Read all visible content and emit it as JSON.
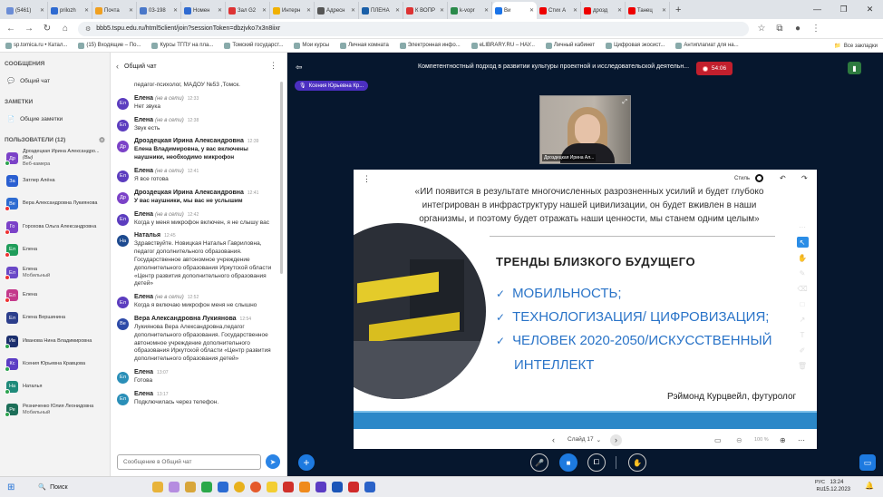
{
  "browser": {
    "tabs": [
      {
        "label": "(5461)",
        "color": "#6b8dd6"
      },
      {
        "label": "prilozh",
        "color": "#2e6ad1"
      },
      {
        "label": "Почта",
        "color": "#f0a020"
      },
      {
        "label": "03-198",
        "color": "#4a78c9"
      },
      {
        "label": "Номен",
        "color": "#2e6ad1"
      },
      {
        "label": "Зал G2",
        "color": "#d33"
      },
      {
        "label": "Интерн",
        "color": "#f0b000"
      },
      {
        "label": "Адресн",
        "color": "#555"
      },
      {
        "label": "ПЛЕНА",
        "color": "#1a5fa8"
      },
      {
        "label": "К ВОПР",
        "color": "#d33"
      },
      {
        "label": "k-vopr",
        "color": "#2a8a4a"
      },
      {
        "label": "Ви",
        "color": "#1a73e8"
      },
      {
        "label": "Стих А",
        "color": "#e00"
      },
      {
        "label": "дрозд",
        "color": "#e00"
      },
      {
        "label": "Танец",
        "color": "#e00"
      }
    ],
    "active_tab_index": 11,
    "new_tab": "+",
    "url": "bbb5.tspu.edu.ru/html5client/join?sessionToken=dbzjvko7x3n8iixr",
    "bookmarks": [
      "sp.tomica.ru • Катал...",
      "(15) Входящие – По...",
      "Курсы ТГПУ на пла...",
      "Томский государст...",
      "Мои курсы",
      "Личная комната",
      "Электронная инфо...",
      "eLIBRARY.RU – НАУ...",
      "Личный кабинет",
      "Цифровая экосист...",
      "Антиплагиат для на..."
    ],
    "all_bookmarks": "Все закладки"
  },
  "sidebar": {
    "messages_header": "СООБЩЕНИЯ",
    "public_chat": "Общий чат",
    "notes_header": "ЗАМЕТКИ",
    "shared_notes": "Общие заметки",
    "users_header": "ПОЛЬЗОВАТЕЛИ (12)",
    "users": [
      {
        "initials": "Др",
        "name": "Дроздецкая Ирина Александро...",
        "note": "(Вы)",
        "sub": "Веб-камера",
        "color": "#7b42c8",
        "dot": "#2ea44f"
      },
      {
        "initials": "За",
        "name": "Затлер Алёна",
        "sub": "",
        "color": "#2a5fd1",
        "dot": ""
      },
      {
        "initials": "Ве",
        "name": "Вера Александровна Лукиянова",
        "sub": "",
        "color": "#2d6bd1",
        "dot": "#e33"
      },
      {
        "initials": "Го",
        "name": "Горохова Ольга Александровна",
        "sub": "",
        "color": "#7b42c8",
        "dot": "#e33"
      },
      {
        "initials": "Ел",
        "name": "Елена",
        "sub": "",
        "color": "#1f9d5a",
        "dot": "#e33"
      },
      {
        "initials": "Ел",
        "name": "Елена",
        "sub": "Мобильный",
        "color": "#6a48c7",
        "dot": "#e33"
      },
      {
        "initials": "Ел",
        "name": "Елена",
        "sub": "",
        "color": "#c43a8c",
        "dot": "#e33"
      },
      {
        "initials": "Ел",
        "name": "Елена Вершинина",
        "sub": "",
        "color": "#2c3e8c",
        "dot": ""
      },
      {
        "initials": "Ив",
        "name": "Иванова Нина Владимировна",
        "sub": "",
        "color": "#1c2f6e",
        "dot": "#2ea44f"
      },
      {
        "initials": "Кс",
        "name": "Ксения Юрьевна Кравцова",
        "sub": "",
        "color": "#5b3cc4",
        "dot": "#2ea44f"
      },
      {
        "initials": "На",
        "name": "Наталья",
        "sub": "",
        "color": "#1f8a7a",
        "dot": "#2ea44f"
      },
      {
        "initials": "Ре",
        "name": "Резниченко Юлия Леонидовна",
        "sub": "Мобильный",
        "color": "#1c6e58",
        "dot": "#2ea44f"
      }
    ]
  },
  "chat": {
    "back": "Общий чат",
    "messages": [
      {
        "initials": "",
        "name": "",
        "offline": "",
        "time": "",
        "text": "педагог-психолог, МАДОУ №53 ,Томск.",
        "color": "",
        "bold": false
      },
      {
        "initials": "Ел",
        "name": "Елена",
        "offline": "(не в сети)",
        "time": "12:33",
        "text": "Нет звука",
        "color": "#5c3dbf",
        "bold": false
      },
      {
        "initials": "Ел",
        "name": "Елена",
        "offline": "(не в сети)",
        "time": "12:38",
        "text": "Звук есть",
        "color": "#5c3dbf",
        "bold": false
      },
      {
        "initials": "Др",
        "name": "Дроздецкая Ирина Александровна",
        "offline": "",
        "time": "12:39",
        "text": "Елена Владимировна, у вас включены наушники, необходимо микрофон",
        "color": "#7b42c8",
        "bold": true
      },
      {
        "initials": "Ел",
        "name": "Елена",
        "offline": "(не в сети)",
        "time": "12:41",
        "text": "Я все готова",
        "color": "#5c3dbf",
        "bold": false
      },
      {
        "initials": "Др",
        "name": "Дроздецкая Ирина Александровна",
        "offline": "",
        "time": "12:41",
        "text": "У вас наушники, мы вас не услышим",
        "color": "#7b42c8",
        "bold": true
      },
      {
        "initials": "Ел",
        "name": "Елена",
        "offline": "(не в сети)",
        "time": "12:42",
        "text": "Когда у меня микрофон включен, я не слышу вас",
        "color": "#5c3dbf",
        "bold": false
      },
      {
        "initials": "На",
        "name": "Наталья",
        "offline": "",
        "time": "12:45",
        "text": "Здравствуйте. Новицкая Наталья Гавриловна, педагог дополнительного образования. Государственное автономное учреждение дополнительного образования Иркутской области «Центр развития дополнительного образования детей»",
        "color": "#1d4a8f",
        "bold": false
      },
      {
        "initials": "Ел",
        "name": "Елена",
        "offline": "(не в сети)",
        "time": "12:52",
        "text": "Когда я включаю микрофон меня не слышно",
        "color": "#5c3dbf",
        "bold": false
      },
      {
        "initials": "Ве",
        "name": "Вера Александровна Лукиянова",
        "offline": "",
        "time": "12:54",
        "text": "Лукиянова Вера Александровна,педагог дополнительного образования. Государственное автономное учреждение дополнительного образования Иркутской области «Центр развития дополнительного образования детей»",
        "color": "#2d4aa8",
        "bold": false
      },
      {
        "initials": "Ел",
        "name": "Елена",
        "offline": "",
        "time": "13:07",
        "text": "Готова",
        "color": "#2a8fb8",
        "bold": false
      },
      {
        "initials": "Ел",
        "name": "Елена",
        "offline": "",
        "time": "13:17",
        "text": "Подключилась через телефон.",
        "color": "#2a8fb8",
        "bold": false
      }
    ],
    "input_placeholder": "Сообщение в Общий чат"
  },
  "meeting": {
    "title": "Компетентностный подход в развитии культуры проектной и исследовательской деятельн...",
    "recording_time": "54:06",
    "presenter": "Ксения Юрьевна Кр...",
    "webcam_name": "Дроздецкая Ирина Ал..."
  },
  "slide": {
    "style_label": "Стиль",
    "quote": "«ИИ появится в результате многочисленных разрозненных усилий и будет глубоко интегрирован в инфраструктуру нашей цивилизации, он будет вживлен в наши организмы, и поэтому будет отражать наши ценности, мы станем одним целым»",
    "heading": "ТРЕНДЫ БЛИЗКОГО БУДУЩЕГО",
    "bullets": [
      "МОБИЛЬНОСТЬ;",
      "ТЕХНОЛОГИЗАЦИЯ/ ЦИФРОВИЗАЦИЯ;",
      "ЧЕЛОВЕК 2020-2050/ИСКУССТВЕННЫЙ",
      "ИНТЕЛЛЕКТ"
    ],
    "author": "Рэймонд Курцвейл, футуролог",
    "slide_label": "Слайд 17",
    "zoom": "100 %"
  },
  "taskbar": {
    "search": "Поиск",
    "lang_top": "РУС",
    "lang_bottom": "RU",
    "time": "13:24",
    "date": "15.12.2023"
  }
}
